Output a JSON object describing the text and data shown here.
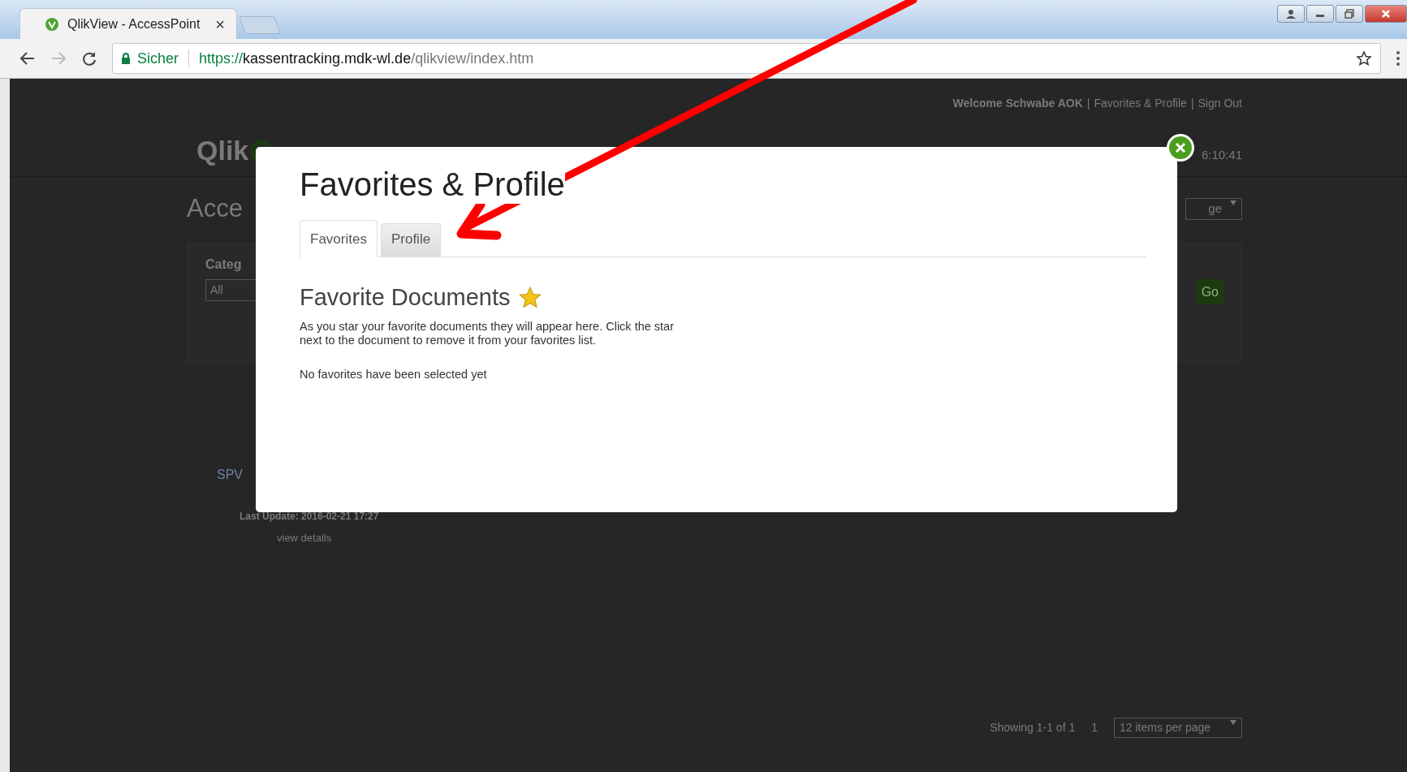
{
  "browser": {
    "tab": {
      "title": "QlikView - AccessPoint",
      "close": "×"
    },
    "address": {
      "security_label": "Sicher",
      "url_scheme": "https://",
      "url_host": "kassentracking.mdk-wl.de",
      "url_path": "/qlikview/index.htm"
    }
  },
  "page": {
    "user_bar": [
      {
        "text": "Welcome Schwabe AOK",
        "kind": "bold"
      },
      {
        "text": "|",
        "kind": "sep"
      },
      {
        "text": "Favorites & Profile",
        "kind": "link"
      },
      {
        "text": "|",
        "kind": "sep"
      },
      {
        "text": "Sign Out",
        "kind": "link"
      }
    ],
    "logo": "Qlik",
    "timestamp": "6:10:41",
    "heading": "Acce",
    "language_select": "ge",
    "category_label": "Categ",
    "category_value": "All",
    "go_button": "Go",
    "document_link": "SPV",
    "last_update": "Last Update: 2016-02-21 17:27",
    "details_link": "view details",
    "pager": {
      "showing": "Showing 1-1 of 1",
      "page": "1",
      "per_page": "12 items per page"
    }
  },
  "modal": {
    "title": "Favorites & Profile",
    "tabs": [
      {
        "label": "Favorites",
        "selected": true
      },
      {
        "label": "Profile",
        "selected": false
      }
    ],
    "section_title": "Favorite Documents",
    "description": "As you star your favorite documents they will appear here. Click the star next to the document to remove it from your favorites list.",
    "empty_message": "No favorites have been selected yet"
  }
}
